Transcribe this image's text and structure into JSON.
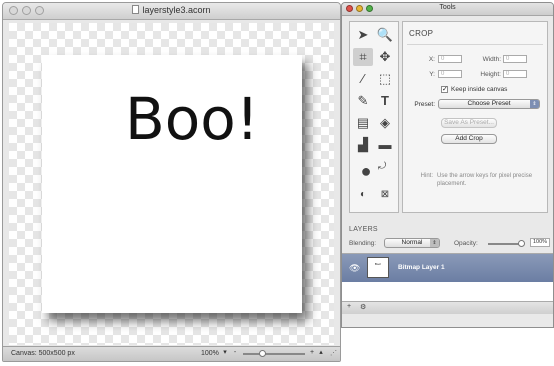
{
  "document": {
    "title": "layerstyle3.acorn",
    "canvas_text": "Boo!",
    "status_canvas": "Canvas: 500x500 px",
    "zoom": "100%",
    "zoom_in": "+",
    "zoom_out": "-",
    "zoom_slider_level": 0.3
  },
  "tools_palette": {
    "title": "Tools",
    "tool_icons": [
      "arrow-select-icon",
      "zoom-icon",
      "crop-icon",
      "move-icon",
      "brush-icon",
      "marquee-icon",
      "eyedropper-icon",
      "text-icon",
      "gradient-icon",
      "paint-bucket-icon",
      "clone-icon",
      "shape-icon",
      "color-swatch-icon",
      "swap-colors-icon",
      "default-colors-icon",
      "expand-icon"
    ],
    "active_tool": "crop-icon",
    "inspector": {
      "title": "CROP",
      "x_label": "X:",
      "x_value": "0",
      "width_label": "Width:",
      "width_value": "0",
      "y_label": "Y:",
      "y_value": "0",
      "height_label": "Height:",
      "height_value": "0",
      "keep_inside_label": "Keep inside canvas",
      "keep_inside_checked": true,
      "preset_label": "Preset:",
      "preset_value": "Choose Preset",
      "save_preset_button": "Save As Preset...",
      "add_crop_button": "Add Crop",
      "hint_label": "Hint:",
      "hint_text": "Use the arrow keys for pixel precise placement."
    }
  },
  "layers": {
    "header": "LAYERS",
    "blending_label": "Blending:",
    "blending_value": "Normal",
    "opacity_label": "Opacity:",
    "opacity_value": "100%",
    "items": [
      {
        "name": "Bitmap Layer 1",
        "thumb_text": "Boo!",
        "visible": true,
        "selected": true
      }
    ],
    "footer_add": "+",
    "footer_gear": "⚙"
  },
  "colors": {
    "selection": "#7385a8",
    "popup_accent": "#7d8fb3",
    "traffic_red": "#e0524a",
    "traffic_yellow": "#e8b634",
    "traffic_green": "#52b34a"
  }
}
